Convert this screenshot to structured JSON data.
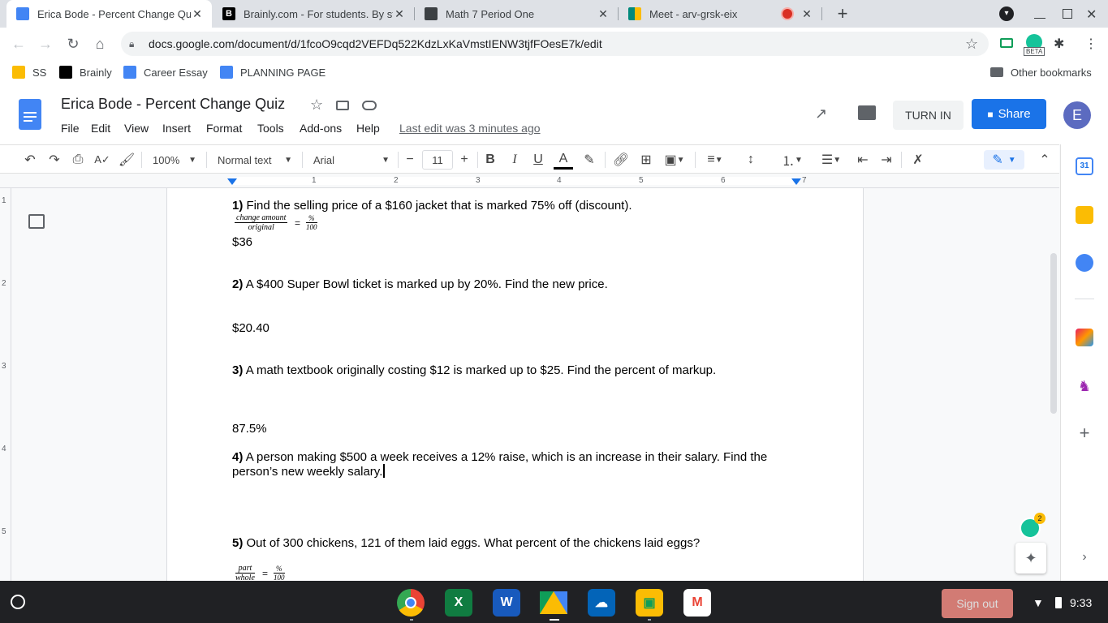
{
  "browser": {
    "tabs": [
      {
        "title": "Erica Bode - Percent Change Qui",
        "close": "✕",
        "favicon": "docs-icon",
        "color": "#4285f4",
        "active": true
      },
      {
        "title": "Brainly.com - For students. By st",
        "close": "✕",
        "favicon": "brainly-icon",
        "color": "#000000",
        "active": false
      },
      {
        "title": "Math 7 Period One",
        "close": "✕",
        "favicon": "classroom-icon",
        "color": "#3c4043",
        "active": false
      },
      {
        "title": "Meet - arv-grsk-eix",
        "close": "✕",
        "favicon": "meet-icon",
        "color": "#00897b",
        "active": false
      }
    ],
    "new_tab": "+",
    "url": "docs.google.com/document/d/1fcoO9cqd2VEFDq522KdzLxKaVmstIENW3tjfFOesE7k/edit",
    "extension_badge": "BETA",
    "bookmarks": [
      {
        "label": "SS",
        "color": "#fbbc04"
      },
      {
        "label": "Brainly",
        "color": "#000000"
      },
      {
        "label": "Career Essay",
        "color": "#4285f4"
      },
      {
        "label": "PLANNING PAGE",
        "color": "#4285f4"
      }
    ],
    "other_bookmarks": "Other bookmarks"
  },
  "docs": {
    "title": "Erica Bode - Percent Change Quiz",
    "menu": [
      "File",
      "Edit",
      "View",
      "Insert",
      "Format",
      "Tools",
      "Add-ons",
      "Help"
    ],
    "last_edit": "Last edit was 3 minutes ago",
    "turn_in": "TURN IN",
    "share": "Share",
    "avatar": "E",
    "toolbar": {
      "zoom": "100%",
      "style": "Normal text",
      "font": "Arial",
      "font_size": "11",
      "minus": "−",
      "plus": "+",
      "bold": "B",
      "italic": "I",
      "underline": "U",
      "text_color": "A"
    },
    "ruler_numbers": [
      "1",
      "2",
      "3",
      "4",
      "5",
      "6",
      "7"
    ],
    "vruler_numbers": [
      "1",
      "2",
      "3",
      "4",
      "5"
    ]
  },
  "document": {
    "q1_num": "1)",
    "q1_text": "Find the selling price of a $160 jacket that is marked 75% off (discount).",
    "f1_num": "change amount",
    "f1_den": "original",
    "f1_eq": "=",
    "f1_rnum": "%",
    "f1_rden": "100",
    "a1": "$36",
    "q2_num": "2)",
    "q2_text": " A $400 Super Bowl ticket is marked up by 20%.  Find the new price.",
    "a2": "$20.40",
    "q3_num": "3)",
    "q3_text": "A math textbook originally costing $12 is marked up to $25.  Find the percent of markup.",
    "a3": "87.5%",
    "q4_num": "4)",
    "q4_text": "A person making $500 a week receives a 12% raise, which is an increase in their salary.  Find the",
    "q4_text2": "person’s new weekly salary.",
    "q5_num": "5)",
    "q5_text": "Out of 300 chickens, 121 of them laid eggs.  What percent of the chickens laid eggs?",
    "f5_num": "part",
    "f5_den": "whole",
    "f5_eq": "=",
    "f5_rnum": "%",
    "f5_rden": "100"
  },
  "grammarly_badge": "2",
  "side_calendar": "31",
  "shelf": {
    "apps": [
      "chrome-icon",
      "excel-icon",
      "word-icon",
      "drive-icon",
      "onedrive-icon",
      "classroom-icon",
      "gmail-icon"
    ],
    "sign_out": "Sign out",
    "time": "9:33"
  }
}
